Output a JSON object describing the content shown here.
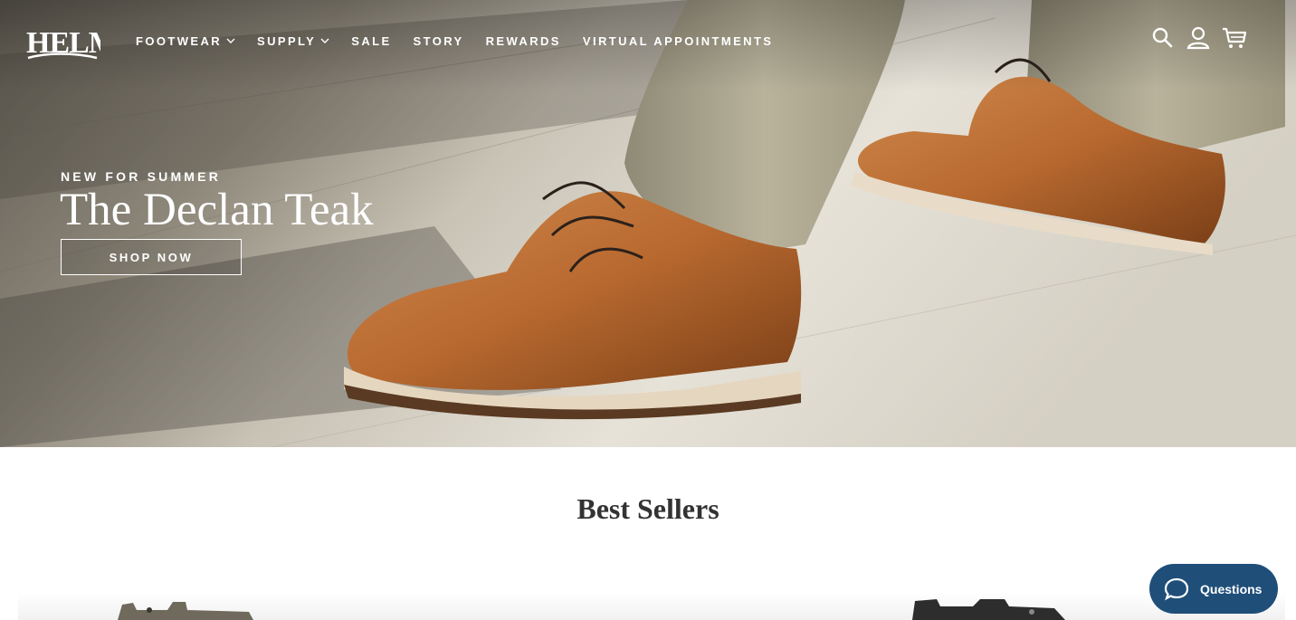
{
  "brand": {
    "logo_text": "HELM"
  },
  "nav": {
    "items": [
      {
        "label": "FOOTWEAR",
        "has_dropdown": true
      },
      {
        "label": "SUPPLY",
        "has_dropdown": true
      },
      {
        "label": "SALE",
        "has_dropdown": false
      },
      {
        "label": "STORY",
        "has_dropdown": false
      },
      {
        "label": "REWARDS",
        "has_dropdown": false
      },
      {
        "label": "VIRTUAL APPOINTMENTS",
        "has_dropdown": false
      }
    ],
    "icons": [
      "search-icon",
      "account-icon",
      "cart-icon"
    ]
  },
  "hero": {
    "eyebrow": "NEW FOR SUMMER",
    "title": "The Declan Teak",
    "cta_label": "SHOP NOW"
  },
  "best_sellers": {
    "title": "Best Sellers"
  },
  "chat": {
    "label": "Questions"
  },
  "colors": {
    "chat_button": "#1f4e79",
    "boot_leather": "#b8692f",
    "pants": "#a9a48e",
    "text_dark": "#333333"
  }
}
